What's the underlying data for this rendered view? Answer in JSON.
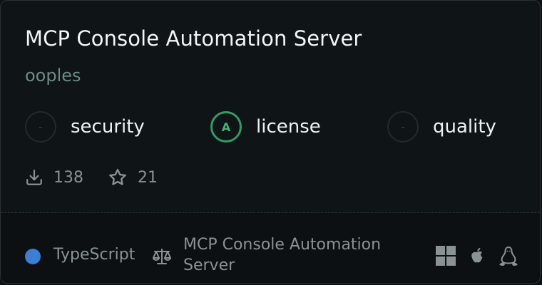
{
  "card": {
    "title": "MCP Console Automation Server",
    "author": "ooples"
  },
  "scores": [
    {
      "grade": "-",
      "label": "security",
      "graded": false
    },
    {
      "grade": "A",
      "label": "license",
      "graded": true
    },
    {
      "grade": "-",
      "label": "quality",
      "graded": false
    }
  ],
  "stats": {
    "downloads": "138",
    "stars": "21"
  },
  "footer": {
    "language": "TypeScript",
    "language_color": "#3b7ed6",
    "license": "MCP Console Automation Server",
    "platforms": [
      "windows-icon",
      "apple-icon",
      "linux-icon"
    ]
  },
  "colors": {
    "grade_accent": "#2f9e66"
  }
}
